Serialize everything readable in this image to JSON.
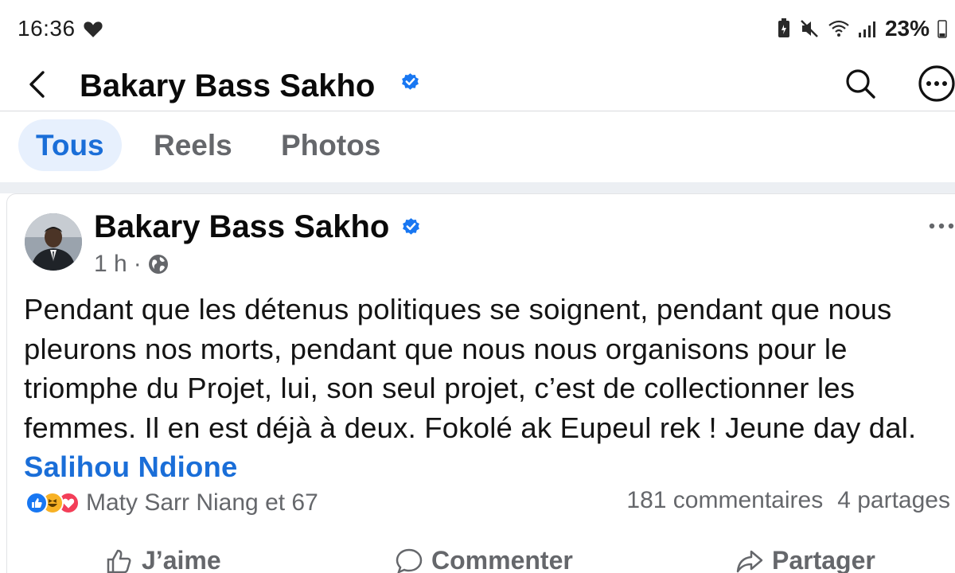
{
  "status_bar": {
    "time": "16:36",
    "battery": "23%",
    "icons": [
      "heart-icon",
      "battery-saver-icon",
      "mute-icon",
      "wifi-icon",
      "signal-icon",
      "battery-icon"
    ]
  },
  "header": {
    "title": "Bakary Bass Sakho",
    "verified": true,
    "icons": [
      "back-arrow-icon",
      "search-icon",
      "more-options-icon"
    ]
  },
  "tabs": [
    {
      "label": "Tous",
      "active": true
    },
    {
      "label": "Reels",
      "active": false
    },
    {
      "label": "Photos",
      "active": false
    }
  ],
  "post": {
    "author": "Bakary Bass Sakho",
    "time": "1 h",
    "separator": "·",
    "audience_icon": "globe-icon",
    "text": "Pendant que les détenus politiques se soignent, pendant que nous pleurons nos morts, pendant que nous nous organisons pour le triomphe du Projet, lui, son seul projet, c’est de collectionner les femmes. Il en est déjà à deux. Fokolé ak Eupeul rek ! Jeune day dal.",
    "mention": "Salihou Ndione",
    "reactions_text": "Maty Sarr Niang et 67",
    "reaction_types": [
      "like",
      "haha",
      "love"
    ],
    "comments": "181 commentaires",
    "shares": "4 partages"
  },
  "actions": {
    "like": "J’aime",
    "comment": "Commenter",
    "share": "Partager"
  },
  "colors": {
    "accent": "#1a6ed8",
    "tab_active_bg": "#e7f0fd",
    "muted_text": "#65676b",
    "divider": "#eceff3"
  }
}
